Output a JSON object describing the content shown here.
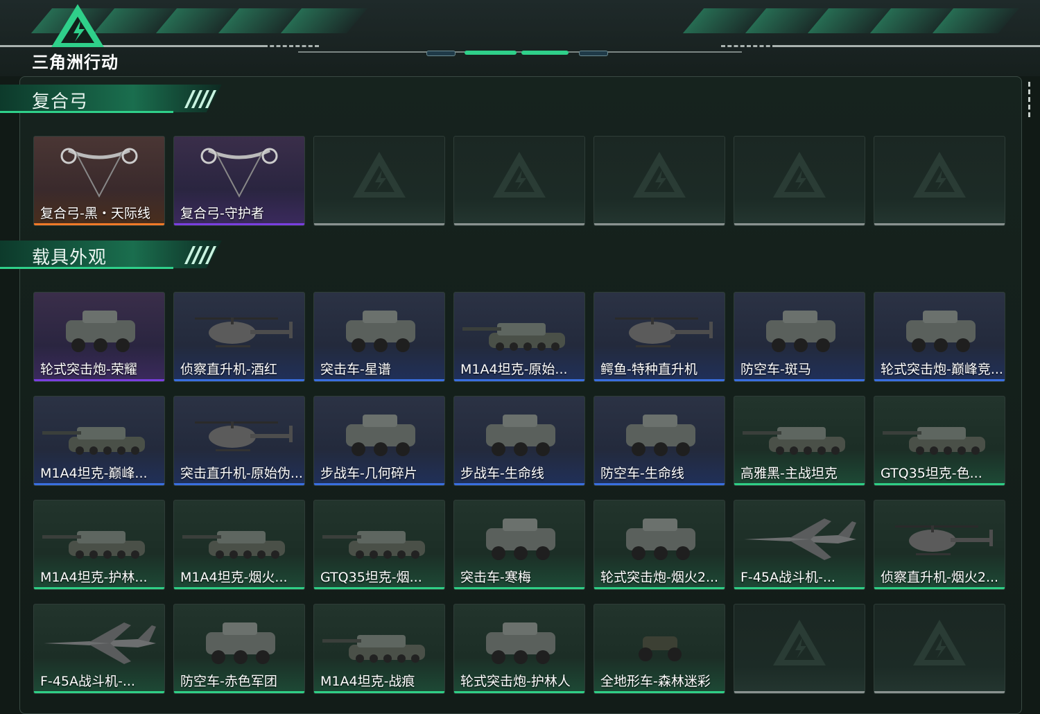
{
  "header": {
    "game_title": "三角洲行动"
  },
  "sections": [
    {
      "title": "复合弓",
      "items": [
        {
          "label": "复合弓-黑・天际线",
          "rarity": "orange",
          "icon": "compound-bow-icon"
        },
        {
          "label": "复合弓-守护者",
          "rarity": "purple",
          "icon": "compound-bow-icon"
        },
        {
          "label": "",
          "rarity": "empty"
        },
        {
          "label": "",
          "rarity": "empty"
        },
        {
          "label": "",
          "rarity": "empty"
        },
        {
          "label": "",
          "rarity": "empty"
        },
        {
          "label": "",
          "rarity": "empty"
        }
      ]
    },
    {
      "title": "载具外观",
      "items": [
        {
          "label": "轮式突击炮-荣耀",
          "rarity": "purple",
          "icon": "wheeled-vehicle-icon"
        },
        {
          "label": "侦察直升机-酒红",
          "rarity": "blue",
          "icon": "helicopter-icon"
        },
        {
          "label": "突击车-星谱",
          "rarity": "blue",
          "icon": "wheeled-vehicle-icon"
        },
        {
          "label": "M1A4坦克-原始...",
          "rarity": "blue",
          "icon": "tank-icon"
        },
        {
          "label": "鳄鱼-特种直升机",
          "rarity": "blue",
          "icon": "helicopter-icon"
        },
        {
          "label": "防空车-斑马",
          "rarity": "blue",
          "icon": "wheeled-vehicle-icon"
        },
        {
          "label": "轮式突击炮-巅峰竞...",
          "rarity": "blue",
          "icon": "wheeled-vehicle-icon"
        },
        {
          "label": "M1A4坦克-巅峰...",
          "rarity": "blue",
          "icon": "tank-icon"
        },
        {
          "label": "突击直升机-原始伪...",
          "rarity": "blue",
          "icon": "helicopter-icon"
        },
        {
          "label": "步战车-几何碎片",
          "rarity": "blue",
          "icon": "wheeled-vehicle-icon"
        },
        {
          "label": "步战车-生命线",
          "rarity": "blue",
          "icon": "wheeled-vehicle-icon"
        },
        {
          "label": "防空车-生命线",
          "rarity": "blue",
          "icon": "wheeled-vehicle-icon"
        },
        {
          "label": "高雅黑-主战坦克",
          "rarity": "green",
          "icon": "tank-icon"
        },
        {
          "label": "GTQ35坦克-色...",
          "rarity": "green",
          "icon": "tank-icon"
        },
        {
          "label": "M1A4坦克-护林...",
          "rarity": "green",
          "icon": "tank-icon"
        },
        {
          "label": "M1A4坦克-烟火...",
          "rarity": "green",
          "icon": "tank-icon"
        },
        {
          "label": "GTQ35坦克-烟...",
          "rarity": "green",
          "icon": "tank-icon"
        },
        {
          "label": "突击车-寒梅",
          "rarity": "green",
          "icon": "wheeled-vehicle-icon"
        },
        {
          "label": "轮式突击炮-烟火2...",
          "rarity": "green",
          "icon": "wheeled-vehicle-icon"
        },
        {
          "label": "F-45A战斗机-...",
          "rarity": "green",
          "icon": "jet-icon"
        },
        {
          "label": "侦察直升机-烟火2...",
          "rarity": "green",
          "icon": "helicopter-icon"
        },
        {
          "label": "F-45A战斗机-...",
          "rarity": "green",
          "icon": "jet-icon"
        },
        {
          "label": "防空车-赤色军团",
          "rarity": "green",
          "icon": "wheeled-vehicle-icon"
        },
        {
          "label": "M1A4坦克-战痕",
          "rarity": "green",
          "icon": "tank-icon"
        },
        {
          "label": "轮式突击炮-护林人",
          "rarity": "green",
          "icon": "wheeled-vehicle-icon"
        },
        {
          "label": "全地形车-森林迷彩",
          "rarity": "green",
          "icon": "atv-icon"
        },
        {
          "label": "",
          "rarity": "empty"
        },
        {
          "label": "",
          "rarity": "empty"
        }
      ]
    }
  ],
  "colors": {
    "accent": "#2fcf86",
    "purple": "#7a3fe0",
    "orange": "#f07a28",
    "blue": "#3a6fe0",
    "empty": "#8a9290"
  }
}
